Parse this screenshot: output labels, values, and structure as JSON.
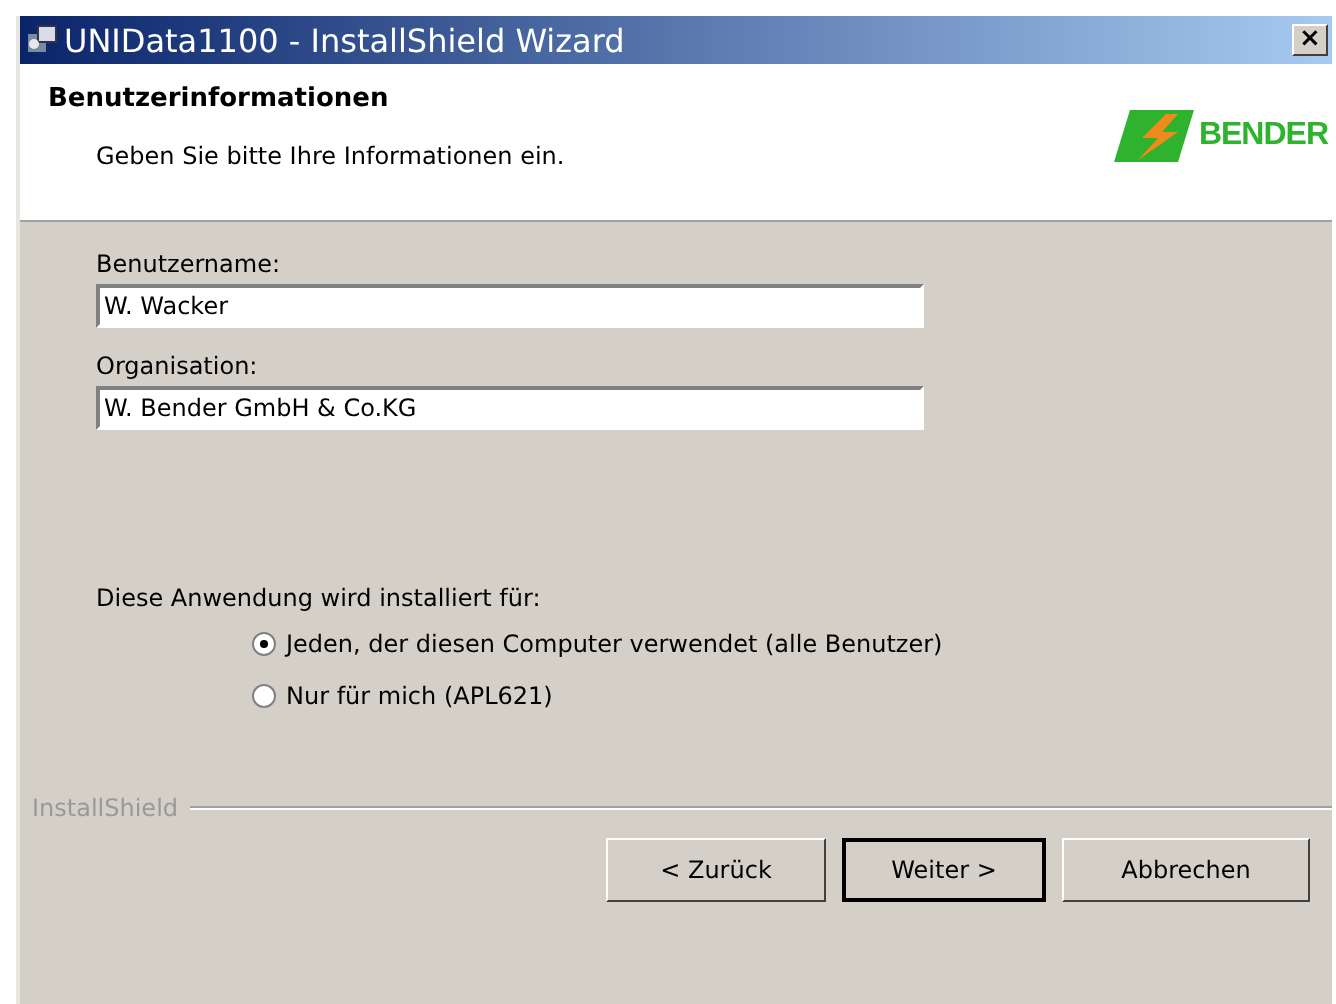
{
  "window": {
    "title": "UNIData1100 - InstallShield Wizard",
    "close": "×"
  },
  "header": {
    "title": "Benutzerinformationen",
    "subtitle": "Geben Sie bitte Ihre Informationen ein.",
    "logo_text": "BENDER"
  },
  "fields": [
    {
      "label": "Benutzername:",
      "value": "W. Wacker"
    },
    {
      "label": "Organisation:",
      "value": "W. Bender GmbH & Co.KG"
    }
  ],
  "install_for": {
    "label": "Diese Anwendung wird installiert für:",
    "options": [
      {
        "label": "Jeden, der diesen Computer verwendet (alle Benutzer)",
        "selected": true
      },
      {
        "label": "Nur für mich (APL621)",
        "selected": false
      }
    ]
  },
  "brand": "InstallShield",
  "buttons": [
    {
      "label": "< Zurück",
      "default": false
    },
    {
      "label": "Weiter >",
      "default": true
    },
    {
      "label": "Abbrechen",
      "default": false
    }
  ]
}
